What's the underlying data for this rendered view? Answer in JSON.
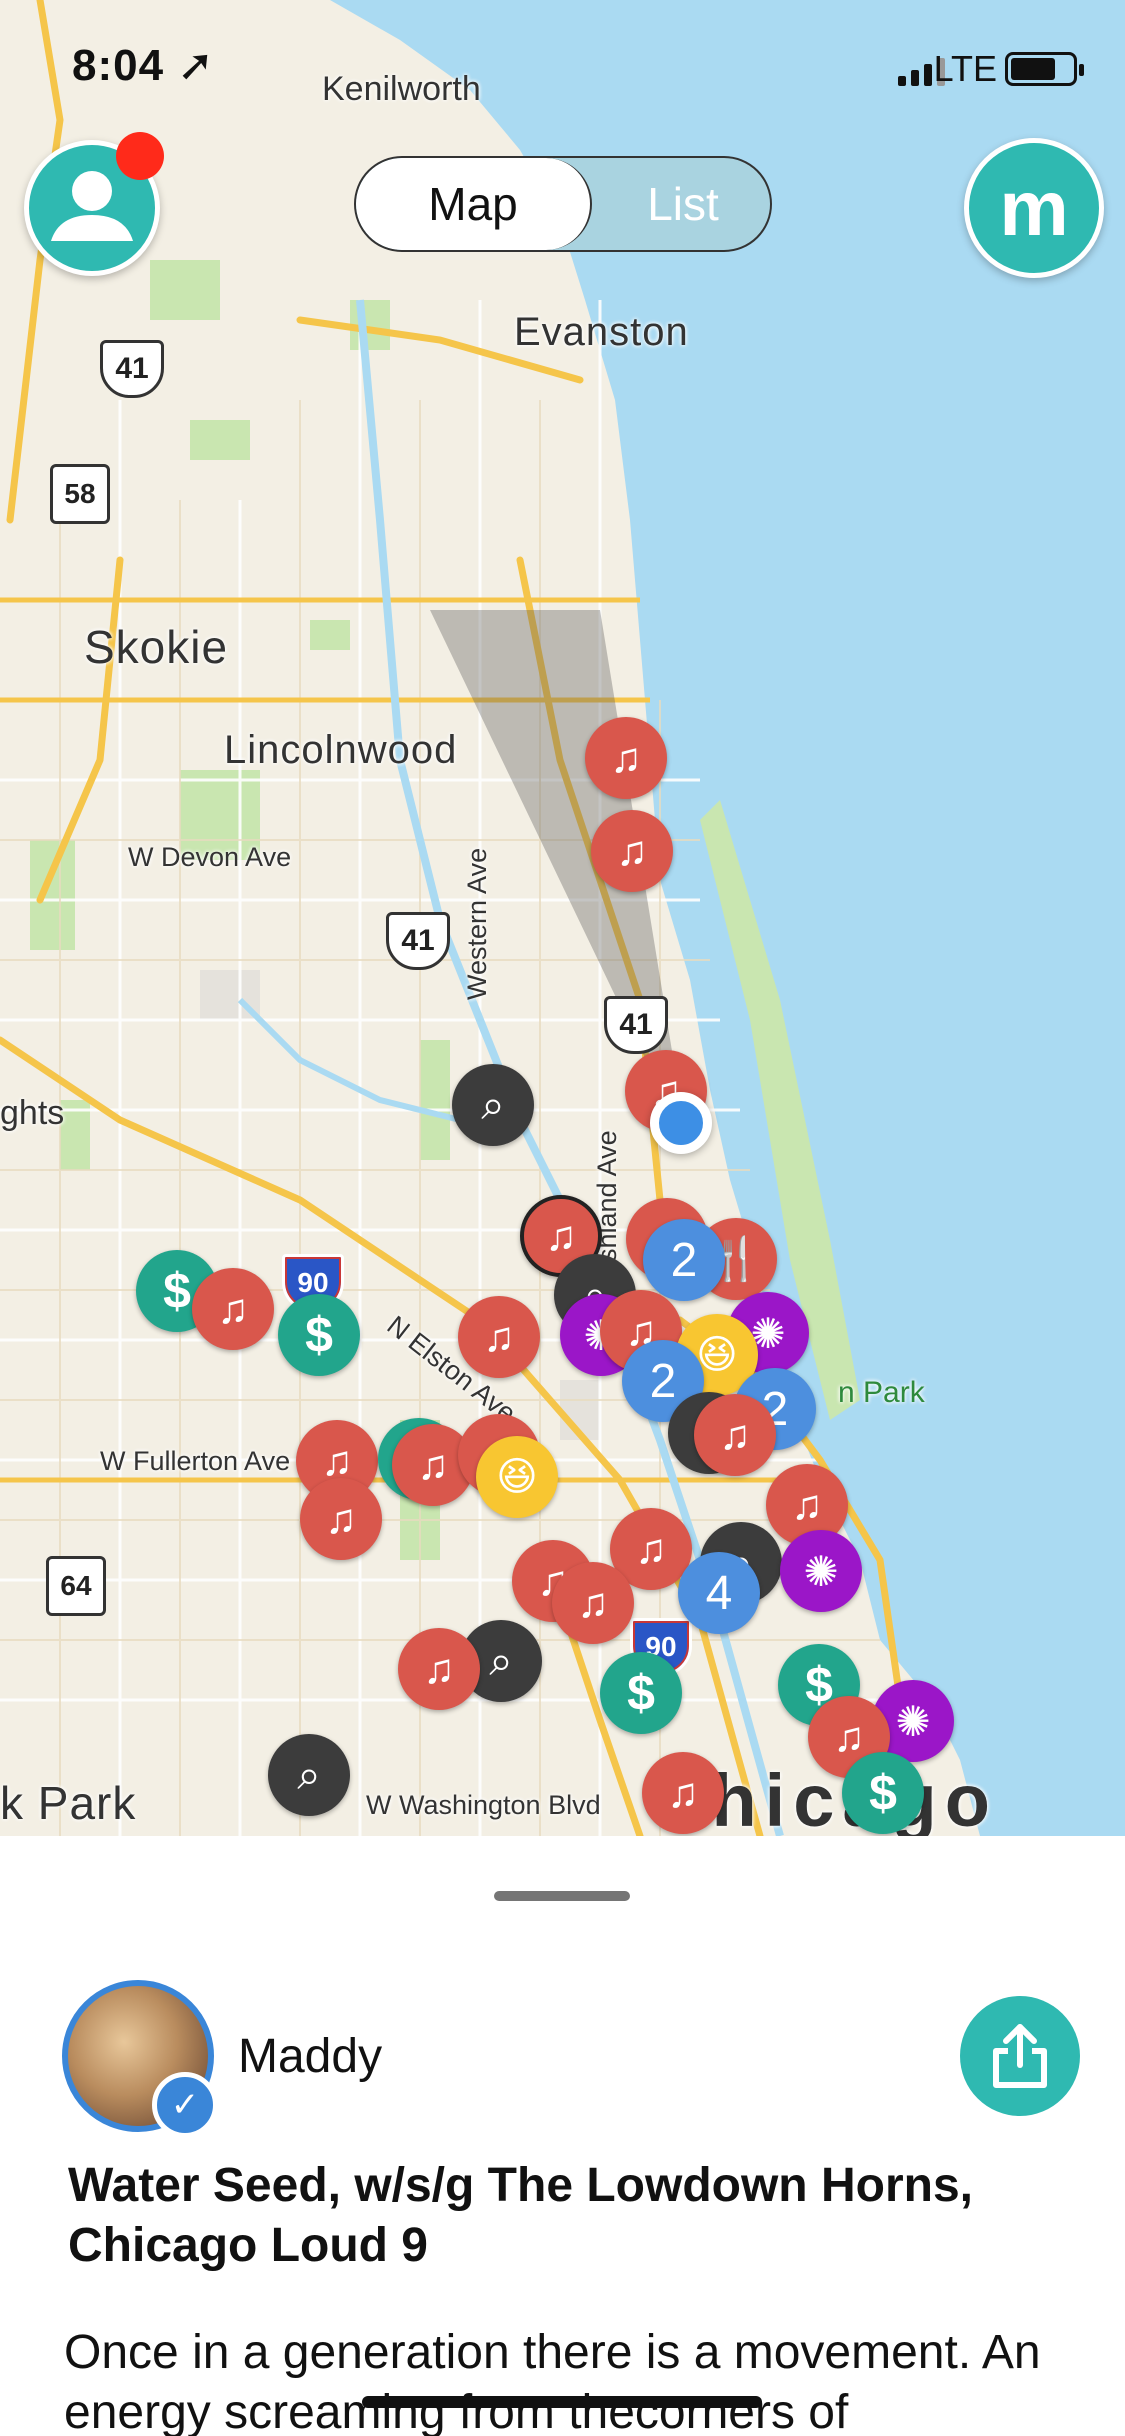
{
  "status_bar": {
    "time": "8:04",
    "carrier": "LTE",
    "location_icon": "location-arrow-icon"
  },
  "header": {
    "tabs": [
      {
        "label": "Map",
        "selected": true
      },
      {
        "label": "List",
        "selected": false
      }
    ],
    "brand_letter": "m",
    "profile_has_notification": true
  },
  "map": {
    "places": {
      "kenilworth": "Kenilworth",
      "evanston": "Evanston",
      "skokie": "Skokie",
      "lincolnwood": "Lincolnwood",
      "devon": "W Devon Ave",
      "western": "Western Ave",
      "ashland": "Ashland Ave",
      "elston": "N Elston Ave",
      "fullerton": "W Fullerton Ave",
      "washington": "W Washington Blvd",
      "heights": "ghts",
      "oak_park": "k Park",
      "chicago": "Chicago",
      "lincoln_park": "n Park"
    },
    "route_shields": [
      "41",
      "58",
      "41",
      "41",
      "90",
      "64",
      "90"
    ],
    "pins": {
      "music": "♫",
      "money": "$",
      "search": "⌕",
      "disco": "✺",
      "emoji": "😆",
      "clusters": [
        "2",
        "2",
        "2",
        "4"
      ]
    },
    "colors": {
      "water": "#aadaf2",
      "land": "#f3efe4",
      "park": "#c9e6b0",
      "highway": "#f5c54a",
      "music_pin": "#d9574c",
      "money_pin": "#22a58c",
      "cluster_pin": "#4d8fde",
      "search_pin": "#3c3c3c",
      "disco_pin": "#9b16c8",
      "accent": "#2fb9b1"
    }
  },
  "sheet": {
    "username": "Maddy",
    "verified": true,
    "event_title": "Water Seed, w/s/g The Lowdown Horns, Chicago Loud 9",
    "description": "Once in a generation there is a movement. An energy screaming from thecorners of"
  }
}
